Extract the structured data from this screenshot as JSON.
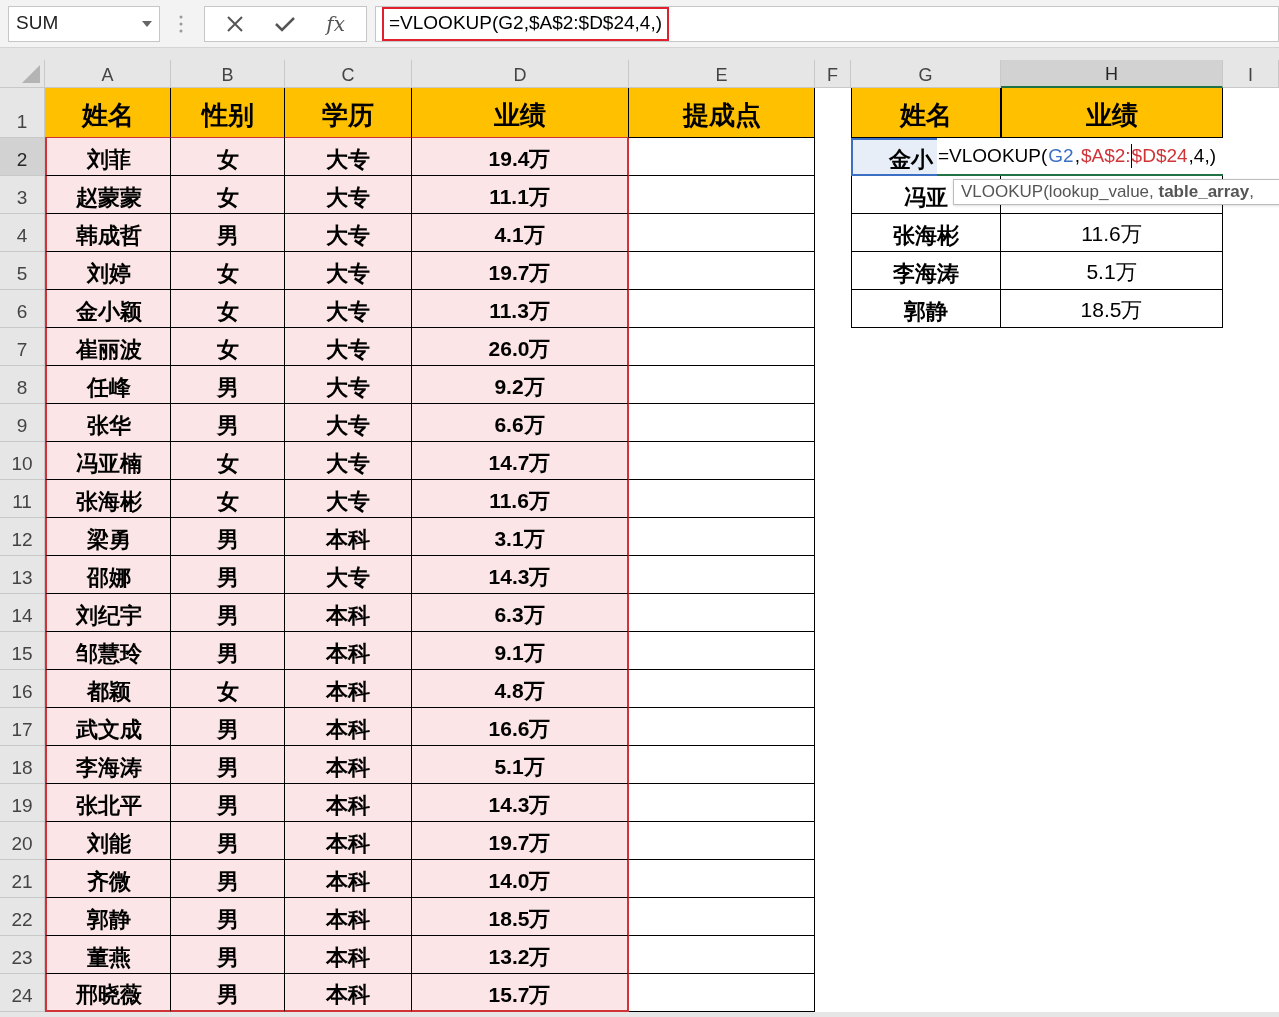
{
  "name_box": {
    "value": "SUM"
  },
  "formula_bar": {
    "fx_label": "fx",
    "formula": "=VLOOKUP(G2,$A$2:$D$24,4,)"
  },
  "columns": [
    {
      "label": "A",
      "selected": false
    },
    {
      "label": "B",
      "selected": false
    },
    {
      "label": "C",
      "selected": false
    },
    {
      "label": "D",
      "selected": false
    },
    {
      "label": "E",
      "selected": false
    },
    {
      "label": "F",
      "selected": false
    },
    {
      "label": "G",
      "selected": false
    },
    {
      "label": "H",
      "selected": true
    },
    {
      "label": "I",
      "selected": false
    }
  ],
  "row_numbers": [
    {
      "label": "1",
      "selected": false
    },
    {
      "label": "2",
      "selected": true
    },
    {
      "label": "3",
      "selected": false
    },
    {
      "label": "4",
      "selected": false
    },
    {
      "label": "5",
      "selected": false
    },
    {
      "label": "6",
      "selected": false
    },
    {
      "label": "7",
      "selected": false
    },
    {
      "label": "8",
      "selected": false
    },
    {
      "label": "9",
      "selected": false
    },
    {
      "label": "10",
      "selected": false
    },
    {
      "label": "11",
      "selected": false
    },
    {
      "label": "12",
      "selected": false
    },
    {
      "label": "13",
      "selected": false
    },
    {
      "label": "14",
      "selected": false
    },
    {
      "label": "15",
      "selected": false
    },
    {
      "label": "16",
      "selected": false
    },
    {
      "label": "17",
      "selected": false
    },
    {
      "label": "18",
      "selected": false
    },
    {
      "label": "19",
      "selected": false
    },
    {
      "label": "20",
      "selected": false
    },
    {
      "label": "21",
      "selected": false
    },
    {
      "label": "22",
      "selected": false
    },
    {
      "label": "23",
      "selected": false
    },
    {
      "label": "24",
      "selected": false
    }
  ],
  "main_table": {
    "headers": [
      "姓名",
      "性别",
      "学历",
      "业绩",
      "提成点"
    ],
    "rows": [
      [
        "刘菲",
        "女",
        "大专",
        "19.4万"
      ],
      [
        "赵蒙蒙",
        "女",
        "大专",
        "11.1万"
      ],
      [
        "韩成哲",
        "男",
        "大专",
        "4.1万"
      ],
      [
        "刘婷",
        "女",
        "大专",
        "19.7万"
      ],
      [
        "金小颖",
        "女",
        "大专",
        "11.3万"
      ],
      [
        "崔丽波",
        "女",
        "大专",
        "26.0万"
      ],
      [
        "任峰",
        "男",
        "大专",
        "9.2万"
      ],
      [
        "张华",
        "男",
        "大专",
        "6.6万"
      ],
      [
        "冯亚楠",
        "女",
        "大专",
        "14.7万"
      ],
      [
        "张海彬",
        "女",
        "大专",
        "11.6万"
      ],
      [
        "梁勇",
        "男",
        "本科",
        "3.1万"
      ],
      [
        "邵娜",
        "男",
        "大专",
        "14.3万"
      ],
      [
        "刘纪宇",
        "男",
        "本科",
        "6.3万"
      ],
      [
        "邹慧玲",
        "男",
        "本科",
        "9.1万"
      ],
      [
        "都颖",
        "女",
        "本科",
        "4.8万"
      ],
      [
        "武文成",
        "男",
        "本科",
        "16.6万"
      ],
      [
        "李海涛",
        "男",
        "本科",
        "5.1万"
      ],
      [
        "张北平",
        "男",
        "本科",
        "14.3万"
      ],
      [
        "刘能",
        "男",
        "本科",
        "19.7万"
      ],
      [
        "齐微",
        "男",
        "本科",
        "14.0万"
      ],
      [
        "郭静",
        "男",
        "本科",
        "18.5万"
      ],
      [
        "董燕",
        "男",
        "本科",
        "13.2万"
      ],
      [
        "邢晓薇",
        "男",
        "本科",
        "15.7万"
      ]
    ]
  },
  "lookup_table": {
    "headers": [
      "姓名",
      "业绩"
    ],
    "rows": [
      {
        "name": "金小",
        "selected": true
      },
      {
        "name": "冯亚",
        "selected": false
      },
      {
        "name": "张海彬",
        "result": "11.6万",
        "selected": false
      },
      {
        "name": "李海涛",
        "result": "5.1万",
        "selected": false
      },
      {
        "name": "郭静",
        "result": "18.5万",
        "selected": false
      }
    ]
  },
  "cell_editor": {
    "segments": [
      {
        "text": "=VLOOKUP(",
        "caret": false
      },
      {
        "text": "G2",
        "color": "#3a6fc4",
        "caret": false
      },
      {
        "text": ",",
        "caret": false
      },
      {
        "text": "$A$2:",
        "color": "#d13438",
        "caret": false
      },
      {
        "text": "$D$24",
        "color": "#d13438",
        "caret": true
      },
      {
        "text": ",4,)",
        "caret": false
      }
    ]
  },
  "tooltip": {
    "text": "VLOOKUP(lookup_value, **table_array**,"
  }
}
